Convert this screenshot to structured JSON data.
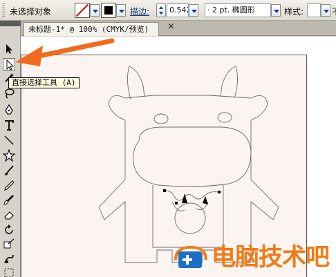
{
  "control_bar": {
    "selection_status": "未选择对象",
    "stroke_label": "描边:",
    "stroke_weight": "0.542",
    "brush_value": "· 2 pt. 椭圆形",
    "style_label": "样式:",
    "right_partial": "不"
  },
  "document_tab": {
    "title": "未标题-1* @ 100% (CMYK/预览)",
    "close_glyph": "×"
  },
  "tooltip": {
    "text": "直接选择工具 (A)"
  },
  "tools": [
    {
      "name": "selection-tool"
    },
    {
      "name": "direct-selection-tool",
      "selected": true
    },
    {
      "name": "magic-wand-tool"
    },
    {
      "name": "lasso-tool"
    },
    {
      "name": "pen-tool"
    },
    {
      "name": "type-tool"
    },
    {
      "name": "line-tool"
    },
    {
      "name": "star-tool"
    },
    {
      "name": "paintbrush-tool"
    },
    {
      "name": "pencil-tool"
    },
    {
      "name": "blob-brush-tool"
    },
    {
      "name": "eraser-tool"
    },
    {
      "name": "rotate-tool"
    },
    {
      "name": "scale-tool"
    },
    {
      "name": "warp-tool"
    },
    {
      "name": "free-transform-tool"
    }
  ],
  "colors": {
    "arrow": "#f26b1d",
    "watermark": "#f07b17",
    "watermark_icon": "#1d6fc4"
  },
  "watermark": {
    "text": "电脑技术吧"
  }
}
